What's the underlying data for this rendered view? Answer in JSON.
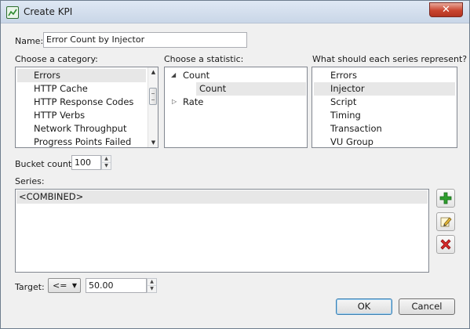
{
  "window": {
    "title": "Create KPI",
    "close_glyph": "✕"
  },
  "name_field": {
    "label": "Name:",
    "value": "Error Count by Injector"
  },
  "category": {
    "label": "Choose a category:",
    "items": [
      "Errors",
      "HTTP Cache",
      "HTTP Response Codes",
      "HTTP Verbs",
      "Network Throughput",
      "Progress Points Failed"
    ],
    "selected_index": 0
  },
  "statistic": {
    "label": "Choose a statistic:",
    "nodes": [
      {
        "label": "Count",
        "expanded": true
      },
      {
        "label": "Count",
        "child": true,
        "selected": true
      },
      {
        "label": "Rate",
        "expanded": false
      }
    ]
  },
  "series_represent": {
    "label": "What should each series represent?",
    "items": [
      "Errors",
      "Injector",
      "Script",
      "Timing",
      "Transaction",
      "VU Group"
    ],
    "selected_index": 1
  },
  "bucket": {
    "label": "Bucket count:",
    "value": "100"
  },
  "series": {
    "label": "Series:",
    "items": [
      "<COMBINED>"
    ]
  },
  "target": {
    "label": "Target:",
    "operator": "<=",
    "value": "50.00"
  },
  "buttons": {
    "ok": "OK",
    "cancel": "Cancel"
  },
  "colors": {
    "add": "#2e9e2e",
    "delete": "#d92b2b",
    "edit": "#e6b93a",
    "title_bar": "#d3deed"
  }
}
